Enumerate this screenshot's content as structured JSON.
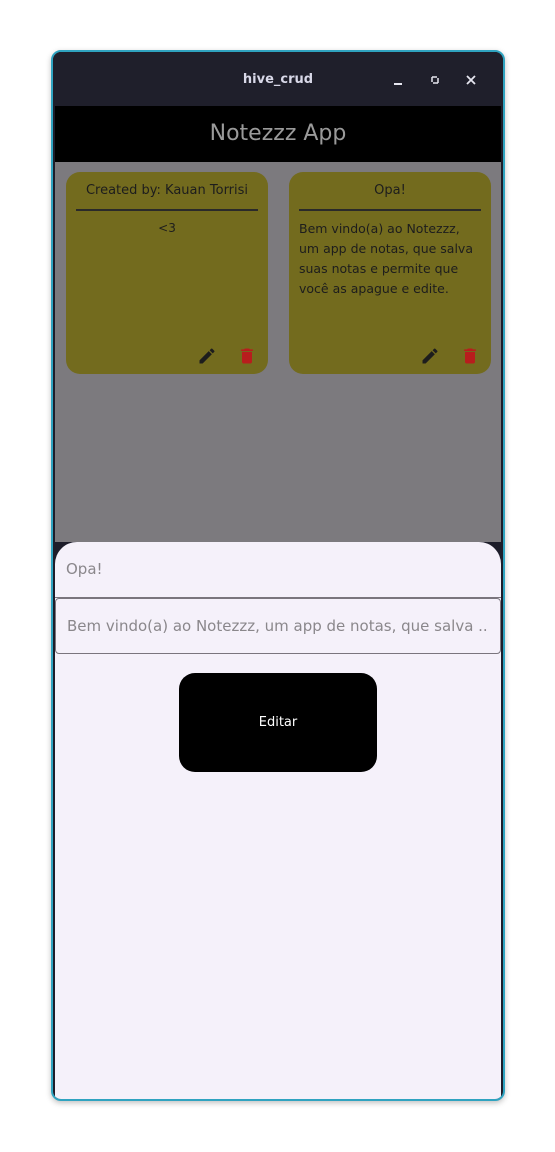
{
  "window": {
    "title": "hive_crud",
    "controls": [
      "minimize",
      "maximize",
      "close"
    ]
  },
  "appbar": {
    "title": "Notezzz App"
  },
  "notes": [
    {
      "title": "Created by: Kauan Torrisi",
      "body": "<3"
    },
    {
      "title": "Opa!",
      "body": "Bem vindo(a) ao Notezzz, um app de notas, que salva suas notas e permite que você as apague e edite."
    }
  ],
  "sheet": {
    "title_value": "Opa!",
    "body_value": "Bem vindo(a) ao Notezzz, um app de notas, que salva ...",
    "button_label": "Editar"
  },
  "colors": {
    "note_bg": "#736b1e",
    "delete_icon": "#b81d1d",
    "backdrop": "#7c7a7e",
    "sheet_bg": "#f5f1fa"
  }
}
